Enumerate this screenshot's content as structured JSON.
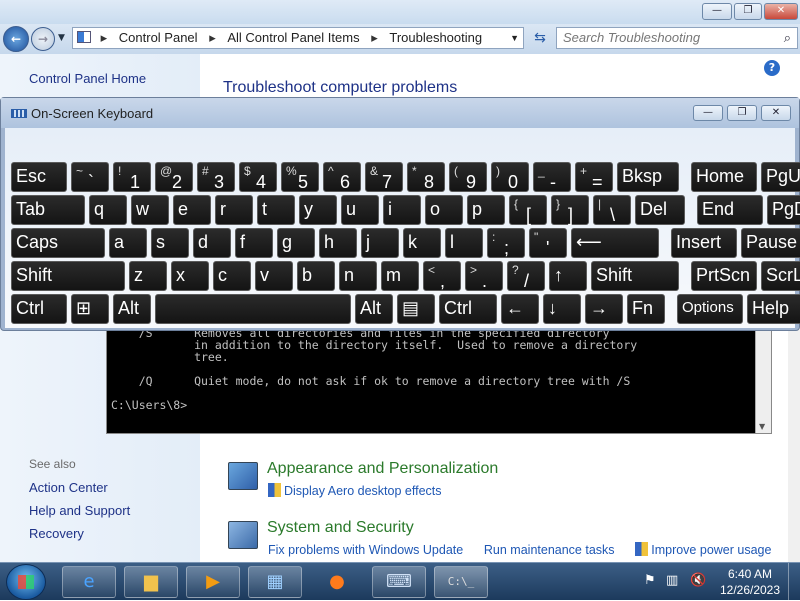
{
  "window": {
    "address_crumbs": [
      "Control Panel",
      "All Control Panel Items",
      "Troubleshooting"
    ],
    "search_placeholder": "Search Troubleshooting",
    "left_pane": {
      "home": "Control Panel Home",
      "see_also_label": "See also",
      "see_also_links": [
        "Action Center",
        "Help and Support",
        "Recovery"
      ]
    },
    "page_title": "Troubleshoot computer problems",
    "categories": [
      {
        "title": "Appearance and Personalization",
        "links": [
          "Display Aero desktop effects"
        ]
      },
      {
        "title": "System and Security",
        "links": [
          "Fix problems with Windows Update",
          "Run maintenance tasks",
          "Improve power usage"
        ]
      }
    ]
  },
  "console": {
    "lines": [
      "    /S      Removes all directories and files in the specified directory",
      "            in addition to the directory itself.  Used to remove a directory",
      "            tree.",
      "",
      "    /Q      Quiet mode, do not ask if ok to remove a directory tree with /S",
      "",
      "C:\\Users\\8>"
    ]
  },
  "osk": {
    "title": "On-Screen Keyboard",
    "rows": [
      [
        {
          "l": "Esc"
        },
        {
          "s": "~",
          "m": "`"
        },
        {
          "s": "!",
          "m": "1"
        },
        {
          "s": "@",
          "m": "2"
        },
        {
          "s": "#",
          "m": "3"
        },
        {
          "s": "$",
          "m": "4"
        },
        {
          "s": "%",
          "m": "5"
        },
        {
          "s": "^",
          "m": "6"
        },
        {
          "s": "&",
          "m": "7"
        },
        {
          "s": "*",
          "m": "8"
        },
        {
          "s": "(",
          "m": "9"
        },
        {
          "s": ")",
          "m": "0"
        },
        {
          "s": "_",
          "m": "-"
        },
        {
          "s": "+",
          "m": "="
        },
        {
          "l": "Bksp"
        },
        {
          "l": "Home"
        },
        {
          "l": "PgUp"
        }
      ],
      [
        {
          "l": "Tab"
        },
        {
          "l": "q"
        },
        {
          "l": "w"
        },
        {
          "l": "e"
        },
        {
          "l": "r"
        },
        {
          "l": "t"
        },
        {
          "l": "y"
        },
        {
          "l": "u"
        },
        {
          "l": "i"
        },
        {
          "l": "o"
        },
        {
          "l": "p"
        },
        {
          "s": "{",
          "m": "["
        },
        {
          "s": "}",
          "m": "]"
        },
        {
          "s": "|",
          "m": "\\"
        },
        {
          "l": "Del"
        },
        {
          "l": "End"
        },
        {
          "l": "PgDn"
        }
      ],
      [
        {
          "l": "Caps"
        },
        {
          "l": "a"
        },
        {
          "l": "s"
        },
        {
          "l": "d"
        },
        {
          "l": "f"
        },
        {
          "l": "g"
        },
        {
          "l": "h"
        },
        {
          "l": "j"
        },
        {
          "l": "k"
        },
        {
          "l": "l"
        },
        {
          "s": ":",
          "m": ";"
        },
        {
          "s": "\"",
          "m": "'"
        },
        {
          "l": "⟵"
        },
        {
          "l": "Insert"
        },
        {
          "l": "Pause"
        }
      ],
      [
        {
          "l": "Shift"
        },
        {
          "l": "z"
        },
        {
          "l": "x"
        },
        {
          "l": "c"
        },
        {
          "l": "v"
        },
        {
          "l": "b"
        },
        {
          "l": "n"
        },
        {
          "l": "m"
        },
        {
          "s": "<",
          "m": ","
        },
        {
          "s": ">",
          "m": "."
        },
        {
          "s": "?",
          "m": "/"
        },
        {
          "l": "↑"
        },
        {
          "l": "Shift"
        },
        {
          "l": "PrtScn"
        },
        {
          "l": "ScrLk"
        }
      ],
      [
        {
          "l": "Ctrl"
        },
        {
          "l": "⊞"
        },
        {
          "l": "Alt"
        },
        {
          "l": ""
        },
        {
          "l": "Alt"
        },
        {
          "l": "▤"
        },
        {
          "l": "Ctrl"
        },
        {
          "l": "←"
        },
        {
          "l": "↓"
        },
        {
          "l": "→"
        },
        {
          "l": "Fn"
        },
        {
          "l": "Options"
        },
        {
          "l": "Help"
        }
      ]
    ]
  },
  "taskbar": {
    "time": "6:40 AM",
    "date": "12/26/2023",
    "apps": [
      "ie-icon",
      "explorer-icon",
      "media-player-icon",
      "control-panel-icon",
      "firefox-icon",
      "osk-icon",
      "cmd-icon"
    ]
  }
}
